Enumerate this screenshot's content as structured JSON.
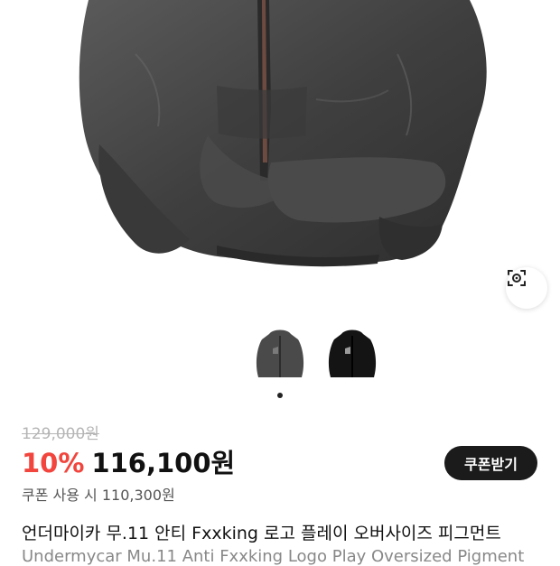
{
  "product": {
    "image_alt": "charcoal pigment zip hoodie",
    "thumbnails": [
      {
        "name": "gray hoodie thumbnail",
        "color": "#4a4a4a"
      },
      {
        "name": "black hoodie thumbnail",
        "color": "#141414"
      }
    ],
    "original_price": "129,000원",
    "discount": "10%",
    "price": "116,100원",
    "coupon_button": "쿠폰받기",
    "coupon_note": "쿠폰 사용 시 110,300원",
    "title_ko": "언더마이카 무.11 안티 Fxxking 로고 플레이 오버사이즈 피그먼트",
    "title_en": "Undermycar Mu.11 Anti Fxxking Logo Play Oversized Pigment"
  },
  "icons": {
    "lens": "image-search-icon"
  },
  "colors": {
    "discount": "#f1453d",
    "button_bg": "#1b1b1b"
  }
}
